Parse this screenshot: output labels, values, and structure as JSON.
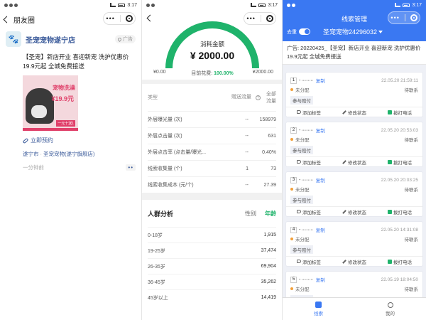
{
  "status_time": "3:17",
  "panel1": {
    "nav_title": "朋友圈",
    "store_name": "圣宠宠物遂宁店",
    "location_chip": "广告",
    "ad_text": "【圣宠】新店开业 喜迎新宠 洗护优惠价19.9元起 全城免费接送",
    "ad_image": {
      "title": "宠物洗澡",
      "price": "¥19.9元",
      "badge": "一元十送1"
    },
    "link_label": "立即预约",
    "city": "遂宁市",
    "location_sep": "·",
    "location_name": "圣宠宠物(遂宁旗舰店)",
    "time": "一分钟前",
    "more": "••"
  },
  "panel2": {
    "spend_label": "消耗金额",
    "spend_value": "¥ 2000.00",
    "gauge_min": "¥0.00",
    "gauge_max": "¥2000.00",
    "progress_label": "目前花费:",
    "progress_value": "100.00%",
    "progress_fraction": 1.0,
    "accent_color": "#1fb36b",
    "stats_header": {
      "type": "类型",
      "paid": "赠送流量",
      "total": "全部流量"
    },
    "stats_rows": [
      {
        "label": "外层曝光量 (次)",
        "paid": "--",
        "total": "158979"
      },
      {
        "label": "外层点击量 (次)",
        "paid": "--",
        "total": "631"
      },
      {
        "label": "外层点击率 (点击量/曝光...",
        "paid": "--",
        "total": "0.40%"
      },
      {
        "label": "线索收集量 (个)",
        "paid": "1",
        "total": "73"
      },
      {
        "label": "线索收集成本 (元/个)",
        "paid": "--",
        "total": "27.39"
      }
    ],
    "crowd": {
      "title": "人群分析",
      "tab_gender": "性别",
      "tab_age": "年龄",
      "rows": [
        {
          "label": "0-18岁",
          "value": "1,915"
        },
        {
          "label": "19-25岁",
          "value": "37,474"
        },
        {
          "label": "26-35岁",
          "value": "69,904"
        },
        {
          "label": "36-45岁",
          "value": "35,262"
        },
        {
          "label": "45岁以上",
          "value": "14,419"
        }
      ]
    }
  },
  "panel3": {
    "title": "线索管理",
    "toggle_label": "去重",
    "account": "圣宠宠物24296032",
    "accent_color": "#3a78f2",
    "ad_text": "广告: 20220425_【圣宠】新店开业 喜迎新宠 洗护优惠价19.9元起 全城免费接送",
    "actions": {
      "tag": "添加标签",
      "edit": "修改状态",
      "call": "拨打电话"
    },
    "copy_label": "复制",
    "leads": [
      {
        "num": "1",
        "phone": "- ·········",
        "time": "22.05.20 21:59:11",
        "status": "未分配",
        "contact": "待联系",
        "tag": "参与赔付"
      },
      {
        "num": "2",
        "phone": "- ·········",
        "time": "22.05.20 20:53:03",
        "status": "未分配",
        "contact": "待联系",
        "tag": "参与赔付"
      },
      {
        "num": "3",
        "phone": "- ·········",
        "time": "22.05.20 20:03:25",
        "status": "未分配",
        "contact": "待联系",
        "tag": "参与赔付"
      },
      {
        "num": "4",
        "phone": "- ·········",
        "time": "22.05.20 14:31:08",
        "status": "未分配",
        "contact": "待联系",
        "tag": "参与赔付"
      },
      {
        "num": "5",
        "phone": "- ·········",
        "time": "22.05.19 18:04:50",
        "status": "未分配",
        "contact": "待联系",
        "tag": "参与赔付"
      }
    ],
    "tabbar": {
      "leads": "线索",
      "mine": "我的"
    }
  }
}
